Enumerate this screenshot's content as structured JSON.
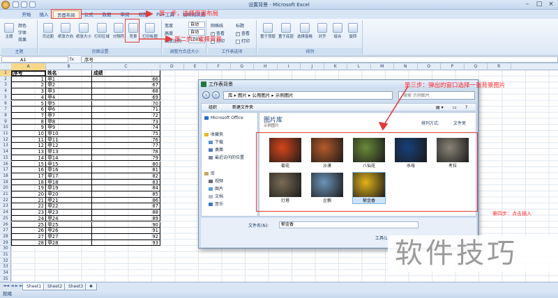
{
  "window": {
    "title": "设置背景 - Microsoft Excel"
  },
  "ribbon": {
    "tabs": [
      "开始",
      "插入",
      "页面布局",
      "公式",
      "数据",
      "审阅",
      "视图",
      "PDF工具",
      "福昕阅读器"
    ],
    "active_tab": "页面布局",
    "groups": [
      {
        "label": "主题",
        "buttons": [
          "主题",
          "颜色",
          "字体",
          "效果"
        ]
      },
      {
        "label": "页面设置",
        "buttons": [
          "页边距",
          "纸张方向",
          "纸张大小",
          "打印区域",
          "分隔符",
          "背景",
          "打印标题"
        ]
      },
      {
        "label": "调整为合适大小",
        "fields": [
          {
            "name": "宽度",
            "value": "自动"
          },
          {
            "name": "高度",
            "value": "自动"
          },
          {
            "name": "缩放比例",
            "value": "100%"
          }
        ]
      },
      {
        "label": "工作表选项",
        "items": [
          "网格线",
          "标题",
          "查看",
          "打印"
        ]
      },
      {
        "label": "排列",
        "buttons": [
          "置于顶层",
          "置于底层",
          "选择窗格",
          "对齐",
          "组合",
          "旋转"
        ]
      }
    ]
  },
  "formula_bar": {
    "cell": "A1",
    "fx": "fx",
    "value": "序号"
  },
  "columns": [
    "A",
    "B",
    "C",
    "D",
    "E",
    "F",
    "G",
    "H",
    "I",
    "J",
    "K",
    "L",
    "M",
    "N",
    "O",
    "P",
    "Q",
    "R"
  ],
  "sheet": {
    "headers": [
      "序号",
      "姓名",
      "成绩"
    ],
    "rows": [
      [
        1,
        "甲1",
        66
      ],
      [
        2,
        "甲2",
        67
      ],
      [
        3,
        "甲3",
        68
      ],
      [
        4,
        "甲4",
        69
      ],
      [
        5,
        "甲5",
        70
      ],
      [
        6,
        "甲6",
        71
      ],
      [
        7,
        "甲7",
        72
      ],
      [
        8,
        "甲8",
        73
      ],
      [
        9,
        "甲9",
        74
      ],
      [
        10,
        "甲10",
        75
      ],
      [
        11,
        "甲11",
        76
      ],
      [
        12,
        "甲12",
        77
      ],
      [
        13,
        "甲13",
        78
      ],
      [
        14,
        "甲14",
        79
      ],
      [
        15,
        "甲15",
        80
      ],
      [
        16,
        "甲16",
        81
      ],
      [
        17,
        "甲17",
        82
      ],
      [
        18,
        "甲18",
        83
      ],
      [
        19,
        "甲19",
        84
      ],
      [
        20,
        "甲20",
        85
      ],
      [
        21,
        "甲21",
        86
      ],
      [
        22,
        "甲22",
        87
      ],
      [
        23,
        "甲23",
        88
      ],
      [
        24,
        "甲24",
        89
      ],
      [
        25,
        "甲25",
        90
      ],
      [
        26,
        "甲26",
        91
      ],
      [
        27,
        "甲27",
        92
      ],
      [
        28,
        "甲28",
        93
      ]
    ],
    "row_count": 35
  },
  "sheet_tabs": [
    "Sheet1",
    "Sheet2",
    "Sheet3"
  ],
  "status": "就绪",
  "dialog": {
    "title": "工作表背景",
    "path": [
      "库",
      "图片",
      "公用图片",
      "示例图片"
    ],
    "search_placeholder": "搜索 示例图片",
    "commands": [
      "组织",
      "新建文件夹"
    ],
    "nav": {
      "top": "Microsoft Office",
      "favorites_label": "收藏夹",
      "favorites": [
        "下载",
        "桌面",
        "最近访问的位置"
      ],
      "libraries_label": "库",
      "libraries": [
        "视频",
        "图片",
        "文档",
        "音乐"
      ]
    },
    "library_title": "图片库",
    "library_sub": "示例图片",
    "sort_label": "排列方式:",
    "sort_value": "文件夹",
    "images": [
      {
        "name": "菊花",
        "color": "#d7451a"
      },
      {
        "name": "沙漠",
        "color": "#b55a2a"
      },
      {
        "name": "八仙花",
        "color": "#6b8a3a"
      },
      {
        "name": "水母",
        "color": "#17407a"
      },
      {
        "name": "考拉",
        "color": "#8a8478"
      },
      {
        "name": "灯塔",
        "color": "#7a6b55"
      },
      {
        "name": "企鹅",
        "color": "#6d93b8"
      },
      {
        "name": "郁金香",
        "color": "#e0b21a"
      }
    ],
    "filename_label": "文件名(N):",
    "filename": "郁金香",
    "tools_label": "工具(L)"
  },
  "annotations": {
    "step1": "第一步，选择页面布局",
    "step2": "第二步：选择背景",
    "step3": "第三步：弹出的窗口选择一张背景图片",
    "step4": "第四步：点击插入",
    "watermark": "软件技巧"
  },
  "accent": "#e23a3a"
}
